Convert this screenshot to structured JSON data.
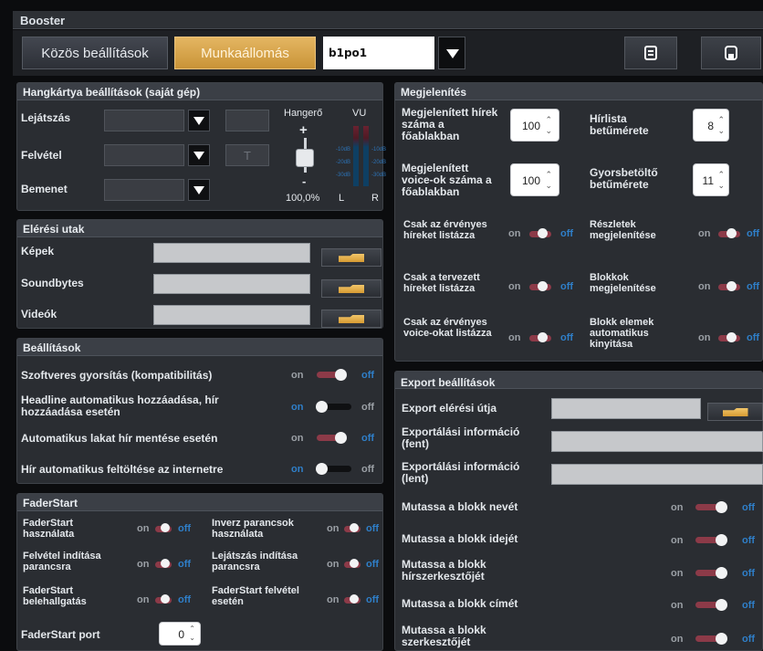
{
  "app": {
    "title": "Booster"
  },
  "toolbar": {
    "common_settings": "Közös beállítások",
    "workstation": "Munkaállomás",
    "station_value": "b1po1"
  },
  "sound": {
    "title": "Hangkártya beállítások (saját gép)",
    "playback": "Lejátszás",
    "record": "Felvétel",
    "input": "Bemenet",
    "t_button": "T",
    "volume_label": "Hangerő",
    "plus": "+",
    "minus": "-",
    "volume_value": "100,0%",
    "vu_label": "VU",
    "vu_left": "L",
    "vu_right": "R",
    "vu_scale": [
      "-10dB",
      "-20dB",
      "-30dB"
    ]
  },
  "paths": {
    "title": "Elérési utak",
    "images": "Képek",
    "soundbytes": "Soundbytes",
    "videos": "Videók"
  },
  "settings": {
    "title": "Beállítások",
    "rows": [
      {
        "label": "Szoftveres gyorsítás (kompatibilitás)",
        "on": "on",
        "off": "off",
        "state": "off"
      },
      {
        "label": "Headline automatikus hozzáadása, hír hozzáadása esetén",
        "on": "on",
        "off": "off",
        "state": "on"
      },
      {
        "label": "Automatikus lakat hír mentése esetén",
        "on": "on",
        "off": "off",
        "state": "off"
      },
      {
        "label": "Hír automatikus feltöltése az internetre",
        "on": "on",
        "off": "off",
        "state": "on"
      }
    ]
  },
  "faderstart": {
    "title": "FaderStart",
    "items": [
      {
        "label": "FaderStart használata",
        "on": "on",
        "off": "off"
      },
      {
        "label": "Inverz parancsok használata",
        "on": "on",
        "off": "off"
      },
      {
        "label": "Felvétel indítása parancsra",
        "on": "on",
        "off": "off"
      },
      {
        "label": "Lejátszás indítása parancsra",
        "on": "on",
        "off": "off"
      },
      {
        "label": "FaderStart belehallgatás",
        "on": "on",
        "off": "off"
      },
      {
        "label": "FaderStart felvétel esetén",
        "on": "on",
        "off": "off"
      }
    ],
    "port_label": "FaderStart port",
    "port_value": "0"
  },
  "display": {
    "title": "Megjelenítés",
    "news_count_label": "Megjelenített hírek száma a főablakban",
    "news_count": "100",
    "voice_count_label": "Megjelenített voice-ok száma a főablakban",
    "voice_count": "100",
    "newslist_font_label": "Hírlista betűmérete",
    "newslist_font": "8",
    "quickload_font_label": "Gyorsbetöltő betűmérete",
    "quickload_font": "11",
    "toggles": [
      {
        "label": "Csak az érvényes híreket listázza",
        "on": "on",
        "off": "off"
      },
      {
        "label": "Részletek megjelenítése",
        "on": "on",
        "off": "off"
      },
      {
        "label": "Csak a tervezett híreket listázza",
        "on": "on",
        "off": "off"
      },
      {
        "label": "Blokkok megjelenítése",
        "on": "on",
        "off": "off"
      },
      {
        "label": "Csak az érvényes voice-okat listázza",
        "on": "on",
        "off": "off"
      },
      {
        "label": "Blokk elemek automatikus kinyitása",
        "on": "on",
        "off": "off"
      }
    ]
  },
  "export": {
    "title": "Export beállítások",
    "path_label": "Export elérési útja",
    "info_top_label": "Exportálási információ (fent)",
    "info_bottom_label": "Exportálási információ (lent)",
    "toggles": [
      {
        "label": "Mutassa a blokk nevét",
        "on": "on",
        "off": "off"
      },
      {
        "label": "Mutassa a blokk idejét",
        "on": "on",
        "off": "off"
      },
      {
        "label": "Mutassa a blokk hírszerkesztőjét",
        "on": "on",
        "off": "off"
      },
      {
        "label": "Mutassa a blokk címét",
        "on": "on",
        "off": "off"
      },
      {
        "label": "Mutassa a blokk szerkesztőjét",
        "on": "on",
        "off": "off"
      }
    ]
  },
  "colors": {
    "accent": "#d9a74f",
    "toggle_blue": "#2f7fc9",
    "toggle_red": "#8c3a48"
  }
}
